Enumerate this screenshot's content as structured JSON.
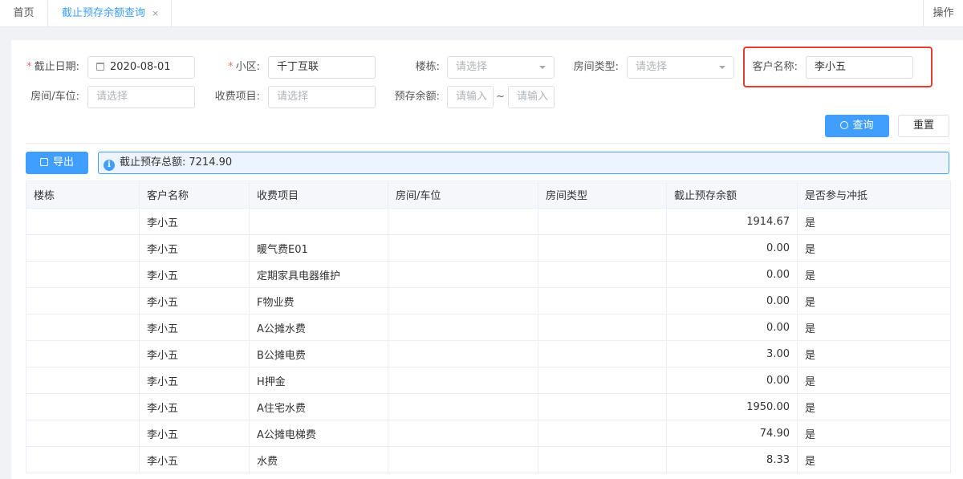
{
  "tabs": {
    "home": "首页",
    "active": "截止预存余额查询",
    "close": "×",
    "operations": "操作"
  },
  "form": {
    "cutoff_date": {
      "label": "截止日期:",
      "required": "*",
      "value": "2020-08-01"
    },
    "community": {
      "label": "小区:",
      "required": "*",
      "value": "千丁互联"
    },
    "building": {
      "label": "楼栋:",
      "placeholder": "请选择"
    },
    "room_type": {
      "label": "房间类型:",
      "placeholder": "请选择"
    },
    "customer_name": {
      "label": "客户名称:",
      "value": "李小五"
    },
    "room_parking": {
      "label": "房间/车位:",
      "placeholder": "请选择"
    },
    "fee_item": {
      "label": "收费项目:",
      "placeholder": "请选择"
    },
    "balance": {
      "label": "预存余额:",
      "min_placeholder": "请输入",
      "max_placeholder": "请输入",
      "separator": "~"
    }
  },
  "buttons": {
    "query": "查询",
    "reset": "重置",
    "export": "导出"
  },
  "summary": {
    "label": "截止预存总额:",
    "value": "7214.90"
  },
  "colors": {
    "primary": "#409eff",
    "highlight_border": "#e53d2f",
    "required": "#f56c6c"
  },
  "table": {
    "columns": [
      "楼栋",
      "客户名称",
      "收费项目",
      "房间/车位",
      "房间类型",
      "截止预存余额",
      "是否参与冲抵"
    ],
    "rows": [
      {
        "building": "",
        "customer": "李小五",
        "item": "",
        "room": "",
        "room_type": "",
        "balance": "1914.67",
        "offset": "是"
      },
      {
        "building": "",
        "customer": "李小五",
        "item": "暖气费E01",
        "room": "",
        "room_type": "",
        "balance": "0.00",
        "offset": "是"
      },
      {
        "building": "",
        "customer": "李小五",
        "item": "定期家具电器维护",
        "room": "",
        "room_type": "",
        "balance": "0.00",
        "offset": "是"
      },
      {
        "building": "",
        "customer": "李小五",
        "item": "F物业费",
        "room": "",
        "room_type": "",
        "balance": "0.00",
        "offset": "是"
      },
      {
        "building": "",
        "customer": "李小五",
        "item": "A公摊水费",
        "room": "",
        "room_type": "",
        "balance": "0.00",
        "offset": "是"
      },
      {
        "building": "",
        "customer": "李小五",
        "item": "B公摊电费",
        "room": "",
        "room_type": "",
        "balance": "3.00",
        "offset": "是"
      },
      {
        "building": "",
        "customer": "李小五",
        "item": "H押金",
        "room": "",
        "room_type": "",
        "balance": "0.00",
        "offset": "是"
      },
      {
        "building": "",
        "customer": "李小五",
        "item": "A住宅水费",
        "room": "",
        "room_type": "",
        "balance": "1950.00",
        "offset": "是"
      },
      {
        "building": "",
        "customer": "李小五",
        "item": "A公摊电梯费",
        "room": "",
        "room_type": "",
        "balance": "74.90",
        "offset": "是"
      },
      {
        "building": "",
        "customer": "李小五",
        "item": "水费",
        "room": "",
        "room_type": "",
        "balance": "8.33",
        "offset": "是"
      }
    ]
  }
}
